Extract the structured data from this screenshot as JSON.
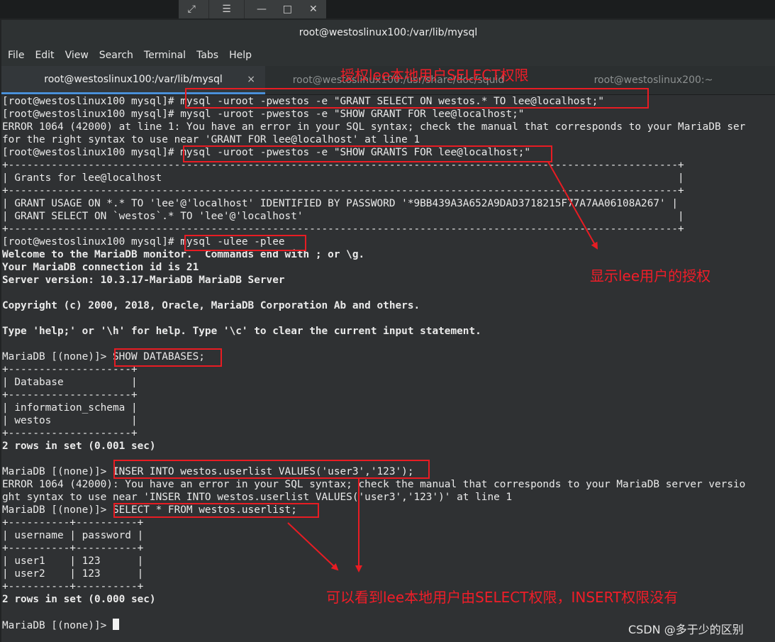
{
  "window": {
    "title": "root@westoslinux100:/var/lib/mysql",
    "menu": [
      "File",
      "Edit",
      "View",
      "Search",
      "Terminal",
      "Tabs",
      "Help"
    ],
    "tabs": [
      {
        "label": "root@westoslinux100:/var/lib/mysql",
        "close": "×"
      },
      {
        "label": "root@westoslinux100:/usr/share/doc/squid"
      },
      {
        "label": "root@westoslinux200:~"
      }
    ]
  },
  "terminal": {
    "lines": [
      "[root@westoslinux100 mysql]# mysql -uroot -pwestos -e \"GRANT SELECT ON westos.* TO lee@localhost;\"",
      "[root@westoslinux100 mysql]# mysql -uroot -pwestos -e \"SHOW GRANT FOR lee@localhost;\"",
      "ERROR 1064 (42000) at line 1: You have an error in your SQL syntax; check the manual that corresponds to your MariaDB ser",
      "for the right syntax to use near 'GRANT FOR lee@localhost' at line 1",
      "[root@westoslinux100 mysql]# mysql -uroot -pwestos -e \"SHOW GRANTS FOR lee@localhost;\"",
      "+-------------------------------------------------------------------------------------------------------------+",
      "| Grants for lee@localhost                                                                                    |",
      "+-------------------------------------------------------------------------------------------------------------+",
      "| GRANT USAGE ON *.* TO 'lee'@'localhost' IDENTIFIED BY PASSWORD '*9BB439A3A652A9DAD3718215F77A7AA06108A267' |",
      "| GRANT SELECT ON `westos`.* TO 'lee'@'localhost'                                                             |",
      "+-------------------------------------------------------------------------------------------------------------+",
      "[root@westoslinux100 mysql]# mysql -ulee -plee",
      "Welcome to the MariaDB monitor.  Commands end with ; or \\g.",
      "Your MariaDB connection id is 21",
      "Server version: 10.3.17-MariaDB MariaDB Server",
      "",
      "Copyright (c) 2000, 2018, Oracle, MariaDB Corporation Ab and others.",
      "",
      "Type 'help;' or '\\h' for help. Type '\\c' to clear the current input statement.",
      "",
      "MariaDB [(none)]> SHOW DATABASES;",
      "+--------------------+",
      "| Database           |",
      "+--------------------+",
      "| information_schema |",
      "| westos             |",
      "+--------------------+",
      "2 rows in set (0.001 sec)",
      "",
      "MariaDB [(none)]> INSER INTO westos.userlist VALUES('user3','123');",
      "ERROR 1064 (42000): You have an error in your SQL syntax; check the manual that corresponds to your MariaDB server versio",
      "ght syntax to use near 'INSER INTO westos.userlist VALUES('user3','123')' at line 1",
      "MariaDB [(none)]> SELECT * FROM westos.userlist;",
      "+----------+----------+",
      "| username | password |",
      "+----------+----------+",
      "| user1    | 123      |",
      "| user2    | 123      |",
      "+----------+----------+",
      "2 rows in set (0.000 sec)",
      "",
      "MariaDB [(none)]> "
    ]
  },
  "annotations": {
    "grant_select": "授权lee本地用户SELECT权限",
    "show_grants": "显示lee用户的授权",
    "conclusion": "可以看到lee本地用户由SELECT权限，INSERT权限没有"
  },
  "watermark": "CSDN @多于少的区别",
  "colors": {
    "annotation": "#e81c23",
    "terminal_bg": "#2f3133",
    "terminal_fg": "#eaeaea",
    "tab_indicator": "#4a90d9"
  },
  "icons": {
    "window_controls": [
      "expand-icon",
      "menu-icon",
      "minimize-icon",
      "maximize-icon",
      "close-icon"
    ]
  }
}
